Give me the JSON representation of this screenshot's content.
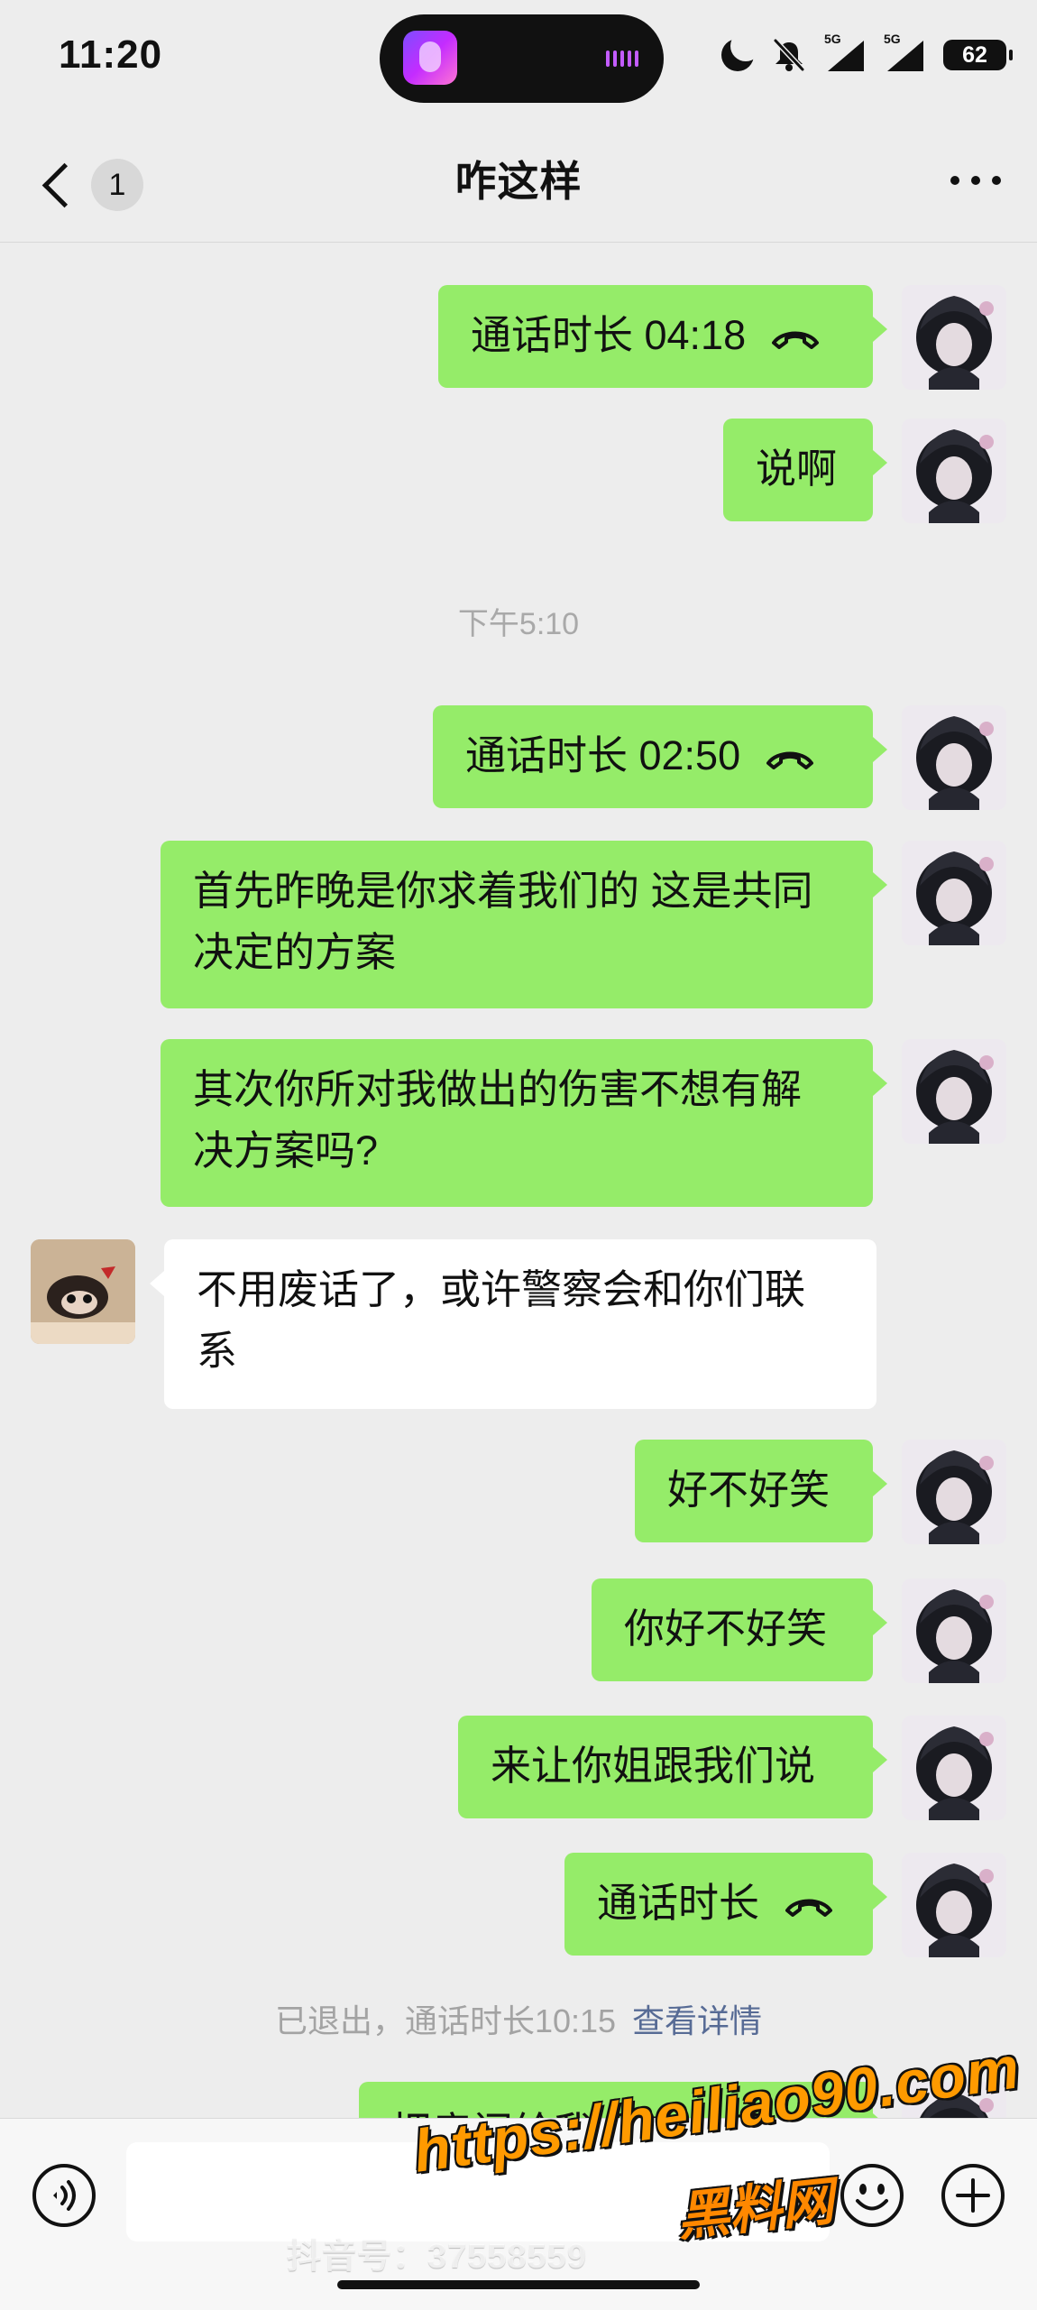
{
  "status_bar": {
    "time": "11:20",
    "network_left": "5G",
    "network_right": "5G",
    "battery": "62",
    "icon_names": [
      "moon-icon",
      "mute-icon",
      "signal-icon",
      "signal-icon",
      "battery-icon"
    ]
  },
  "nav": {
    "unread_count": "1",
    "title": "咋这样",
    "more_icon": "more-icon"
  },
  "messages": [
    {
      "side": "mine",
      "text": "通话时长 04:18",
      "type": "call"
    },
    {
      "side": "mine",
      "text": "说啊",
      "type": "text"
    },
    {
      "type": "timestamp",
      "text": "下午5:10"
    },
    {
      "side": "mine",
      "text": "通话时长 02:50",
      "type": "call"
    },
    {
      "side": "mine",
      "text": "首先昨晚是你求着我们的 这是共同决定的方案",
      "type": "text"
    },
    {
      "side": "mine",
      "text": "其次你所对我做出的伤害不想有解决方案吗?",
      "type": "text"
    },
    {
      "side": "theirs",
      "text": "不用废话了，或许警察会和你们联系",
      "type": "text"
    },
    {
      "side": "mine",
      "text": "好不好笑",
      "type": "text"
    },
    {
      "side": "mine",
      "text": "你好不好笑",
      "type": "text"
    },
    {
      "side": "mine",
      "text": "来让你姐跟我们说",
      "type": "text"
    },
    {
      "side": "mine",
      "text": "通话时长",
      "type": "call"
    },
    {
      "type": "system",
      "text": "已退出，通话时长10:15",
      "link": "查看详情"
    },
    {
      "side": "mine",
      "text": "把房间给我 我来处理",
      "type": "text"
    }
  ],
  "input_bar": {
    "voice_icon": "voice-icon",
    "emoji_icon": "emoji-icon",
    "add_icon": "add-icon"
  },
  "watermarks": {
    "douyin": "抖音号：37558559",
    "url": "https://heiliao90.com",
    "brand": "黑料网"
  }
}
